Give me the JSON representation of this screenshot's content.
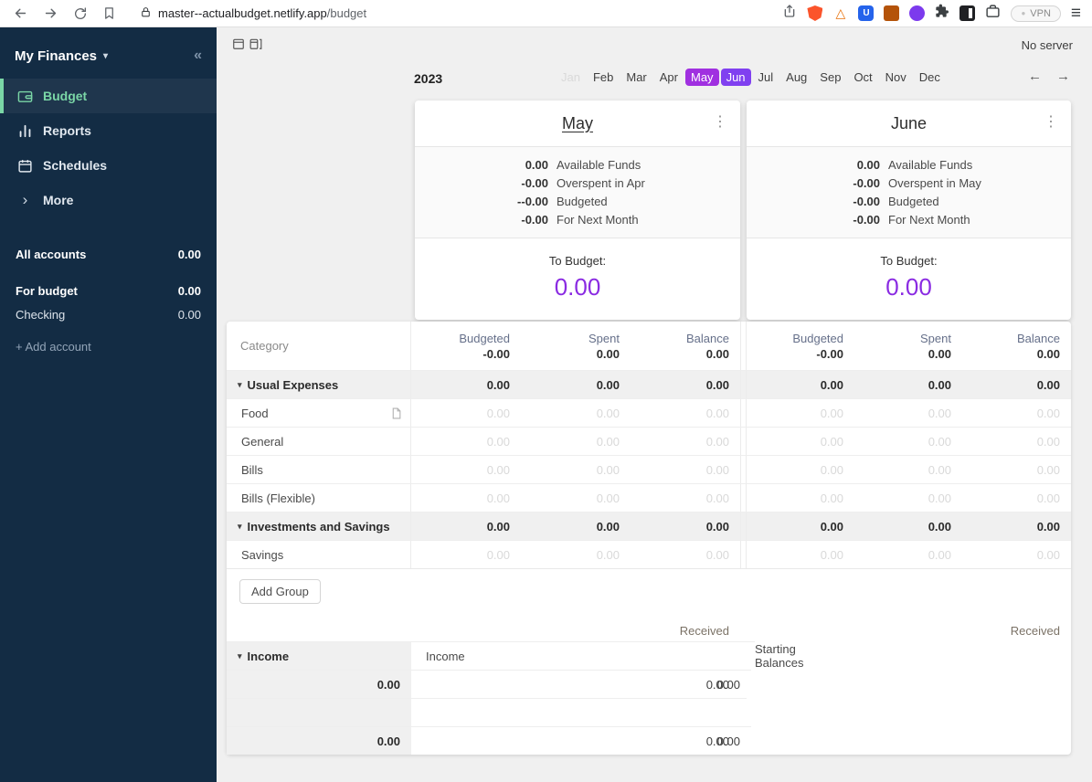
{
  "browser": {
    "url_host": "master--actualbudget.netlify.app",
    "url_path": "/budget",
    "vpn_label": "VPN"
  },
  "topbar": {
    "no_server": "No server"
  },
  "icons": {
    "caret_down": "▾",
    "collapse": "«",
    "chevron_right": "›",
    "kebab": "⋮",
    "triangle_down": "▾",
    "menu": "≡",
    "dot": "●",
    "prev_arrow": "←",
    "next_arrow": "→"
  },
  "sidebar": {
    "title": "My Finances",
    "items": [
      {
        "label": "Budget"
      },
      {
        "label": "Reports"
      },
      {
        "label": "Schedules"
      },
      {
        "label": "More"
      }
    ],
    "accounts": {
      "all_label": "All accounts",
      "all_value": "0.00",
      "for_budget_label": "For budget",
      "for_budget_value": "0.00",
      "checking_label": "Checking",
      "checking_value": "0.00",
      "add_account_label": "+ Add account"
    }
  },
  "month_nav": {
    "year": "2023",
    "months": [
      "Jan",
      "Feb",
      "Mar",
      "Apr",
      "May",
      "Jun",
      "Jul",
      "Aug",
      "Sep",
      "Oct",
      "Nov",
      "Dec"
    ]
  },
  "months": [
    {
      "title": "May",
      "summary": [
        {
          "value": "0.00",
          "label": "Available Funds"
        },
        {
          "value": "-0.00",
          "label": "Overspent in Apr"
        },
        {
          "value": "--0.00",
          "label": "Budgeted"
        },
        {
          "value": "-0.00",
          "label": "For Next Month"
        }
      ],
      "to_budget_label": "To Budget:",
      "to_budget_value": "0.00",
      "totals": {
        "budgeted": "-0.00",
        "spent": "0.00",
        "balance": "0.00"
      }
    },
    {
      "title": "June",
      "summary": [
        {
          "value": "0.00",
          "label": "Available Funds"
        },
        {
          "value": "-0.00",
          "label": "Overspent in May"
        },
        {
          "value": "-0.00",
          "label": "Budgeted"
        },
        {
          "value": "-0.00",
          "label": "For Next Month"
        }
      ],
      "to_budget_label": "To Budget:",
      "to_budget_value": "0.00",
      "totals": {
        "budgeted": "-0.00",
        "spent": "0.00",
        "balance": "0.00"
      }
    }
  ],
  "table": {
    "category_header": "Category",
    "columns": [
      "Budgeted",
      "Spent",
      "Balance"
    ],
    "expense_groups": [
      {
        "name": "Usual Expenses",
        "totals": [
          "0.00",
          "0.00",
          "0.00",
          "0.00",
          "0.00",
          "0.00"
        ],
        "rows": [
          {
            "name": "Food",
            "values": [
              "0.00",
              "0.00",
              "0.00",
              "0.00",
              "0.00",
              "0.00"
            ]
          },
          {
            "name": "General",
            "values": [
              "0.00",
              "0.00",
              "0.00",
              "0.00",
              "0.00",
              "0.00"
            ]
          },
          {
            "name": "Bills",
            "values": [
              "0.00",
              "0.00",
              "0.00",
              "0.00",
              "0.00",
              "0.00"
            ]
          },
          {
            "name": "Bills (Flexible)",
            "values": [
              "0.00",
              "0.00",
              "0.00",
              "0.00",
              "0.00",
              "0.00"
            ]
          }
        ]
      },
      {
        "name": "Investments and Savings",
        "totals": [
          "0.00",
          "0.00",
          "0.00",
          "0.00",
          "0.00",
          "0.00"
        ],
        "rows": [
          {
            "name": "Savings",
            "values": [
              "0.00",
              "0.00",
              "0.00",
              "0.00",
              "0.00",
              "0.00"
            ]
          }
        ]
      }
    ],
    "add_group_label": "Add Group",
    "received_label": "Received",
    "income": {
      "group_name": "Income",
      "group_totals": [
        "0.00",
        "0.00"
      ],
      "rows": [
        {
          "name": "Income",
          "values": [
            "0.00",
            "0.00"
          ]
        },
        {
          "name": "Starting Balances",
          "values": [
            "0.00",
            "0.00"
          ]
        }
      ]
    }
  }
}
